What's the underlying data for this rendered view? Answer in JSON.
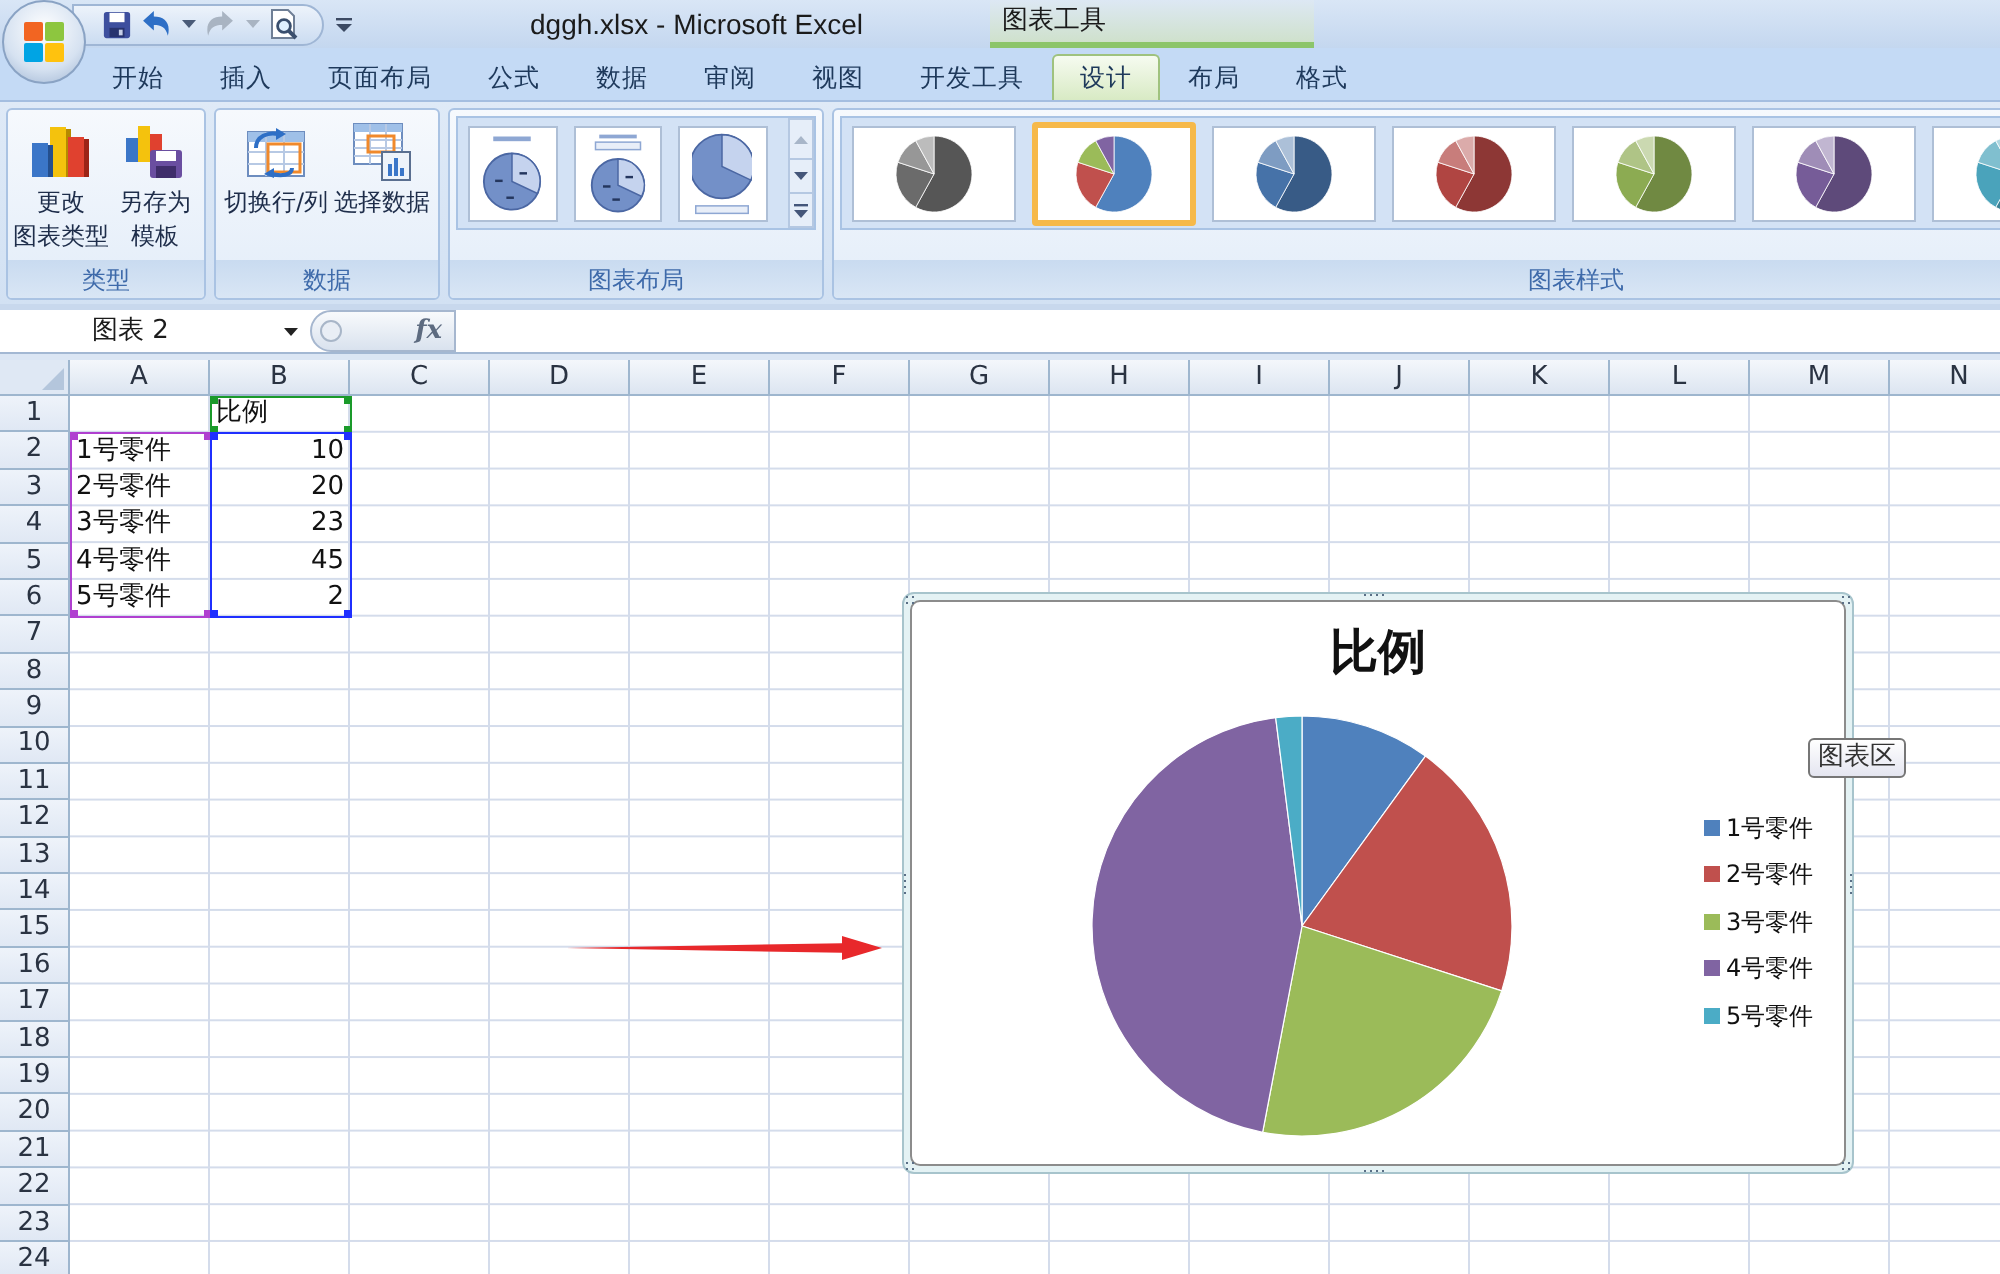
{
  "window": {
    "title": "dggh.xlsx - Microsoft Excel",
    "contextual_title": "图表工具"
  },
  "quick_access": [
    {
      "kind": "save",
      "disabled": false
    },
    {
      "kind": "undo",
      "disabled": false
    },
    {
      "kind": "redo",
      "disabled": true
    },
    {
      "kind": "print_preview",
      "disabled": false
    }
  ],
  "tabs": [
    {
      "label": "开始",
      "selected": false
    },
    {
      "label": "插入",
      "selected": false
    },
    {
      "label": "页面布局",
      "selected": false
    },
    {
      "label": "公式",
      "selected": false
    },
    {
      "label": "数据",
      "selected": false
    },
    {
      "label": "审阅",
      "selected": false
    },
    {
      "label": "视图",
      "selected": false
    },
    {
      "label": "开发工具",
      "selected": false
    },
    {
      "label": "设计",
      "selected": true
    },
    {
      "label": "布局",
      "selected": false
    },
    {
      "label": "格式",
      "selected": false
    }
  ],
  "ribbon": {
    "groups": [
      {
        "kind": "buttons",
        "label": "类型",
        "buttons": [
          {
            "kind": "change_type",
            "lines": [
              "更改",
              "图表类型"
            ]
          },
          {
            "kind": "save_template",
            "lines": [
              "另存为",
              "模板"
            ]
          }
        ]
      },
      {
        "kind": "buttons",
        "label": "数据",
        "buttons": [
          {
            "kind": "switch_row_col",
            "lines": [
              "切换行/列"
            ]
          },
          {
            "kind": "select_data",
            "lines": [
              "选择数据"
            ]
          }
        ]
      },
      {
        "kind": "layout_gallery",
        "label": "图表布局",
        "items": [
          {
            "kind": "title_percent",
            "selected": false
          },
          {
            "kind": "title_legend_percent",
            "selected": false
          },
          {
            "kind": "legend_bottom",
            "selected": false
          }
        ]
      },
      {
        "kind": "style_gallery",
        "label": "图表样式",
        "items": [
          {
            "kind": "mono",
            "color": "#6b6b6b",
            "selected": false
          },
          {
            "kind": "multi",
            "selected": true
          },
          {
            "kind": "mono",
            "color": "#4672a8",
            "selected": false
          },
          {
            "kind": "mono",
            "color": "#b04542",
            "selected": false
          },
          {
            "kind": "mono",
            "color": "#8cab52",
            "selected": false
          },
          {
            "kind": "mono",
            "color": "#765c98",
            "selected": false
          },
          {
            "kind": "mono",
            "color": "#4aa3bb",
            "selected": false
          }
        ]
      }
    ]
  },
  "formula_bar": {
    "name_box": "图表 2",
    "function_button": "fx"
  },
  "sheet": {
    "columns": [
      "A",
      "B",
      "C",
      "D",
      "E",
      "F",
      "G",
      "H",
      "I",
      "J",
      "K",
      "L",
      "M",
      "N"
    ],
    "rows": [
      {
        "label": "1",
        "kind": "header",
        "b": "比例"
      },
      {
        "label": "2",
        "kind": "data",
        "a": "1号零件",
        "b": "10"
      },
      {
        "label": "3",
        "kind": "data",
        "a": "2号零件",
        "b": "20"
      },
      {
        "label": "4",
        "kind": "data",
        "a": "3号零件",
        "b": "23"
      },
      {
        "label": "5",
        "kind": "data",
        "a": "4号零件",
        "b": "45"
      },
      {
        "label": "6",
        "kind": "data",
        "a": "5号零件",
        "b": "2"
      },
      {
        "label": "7",
        "kind": "empty"
      },
      {
        "label": "8",
        "kind": "empty"
      },
      {
        "label": "9",
        "kind": "empty"
      },
      {
        "label": "10",
        "kind": "empty"
      },
      {
        "label": "11",
        "kind": "empty"
      },
      {
        "label": "12",
        "kind": "empty"
      },
      {
        "label": "13",
        "kind": "empty"
      },
      {
        "label": "14",
        "kind": "empty"
      },
      {
        "label": "15",
        "kind": "empty"
      },
      {
        "label": "16",
        "kind": "empty"
      },
      {
        "label": "17",
        "kind": "empty"
      },
      {
        "label": "18",
        "kind": "empty"
      },
      {
        "label": "19",
        "kind": "empty"
      },
      {
        "label": "20",
        "kind": "empty"
      },
      {
        "label": "21",
        "kind": "empty"
      },
      {
        "label": "22",
        "kind": "empty"
      },
      {
        "label": "23",
        "kind": "empty"
      },
      {
        "label": "24",
        "kind": "empty"
      }
    ],
    "highlights": [
      {
        "kind": "series_name",
        "color": "#1a9a2a"
      },
      {
        "kind": "categories",
        "color": "#b040d0"
      },
      {
        "kind": "values",
        "color": "#1f2fff"
      }
    ]
  },
  "chart": {
    "chart_data": {
      "type": "pie",
      "title": "比例",
      "categories": [
        "1号零件",
        "2号零件",
        "3号零件",
        "4号零件",
        "5号零件"
      ],
      "values": [
        10,
        20,
        23,
        45,
        2
      ],
      "colors": [
        "#4f81bd",
        "#c0504d",
        "#9bbb59",
        "#8064a2",
        "#4bacc6"
      ],
      "legend": "right"
    },
    "tooltip": "图表区"
  }
}
